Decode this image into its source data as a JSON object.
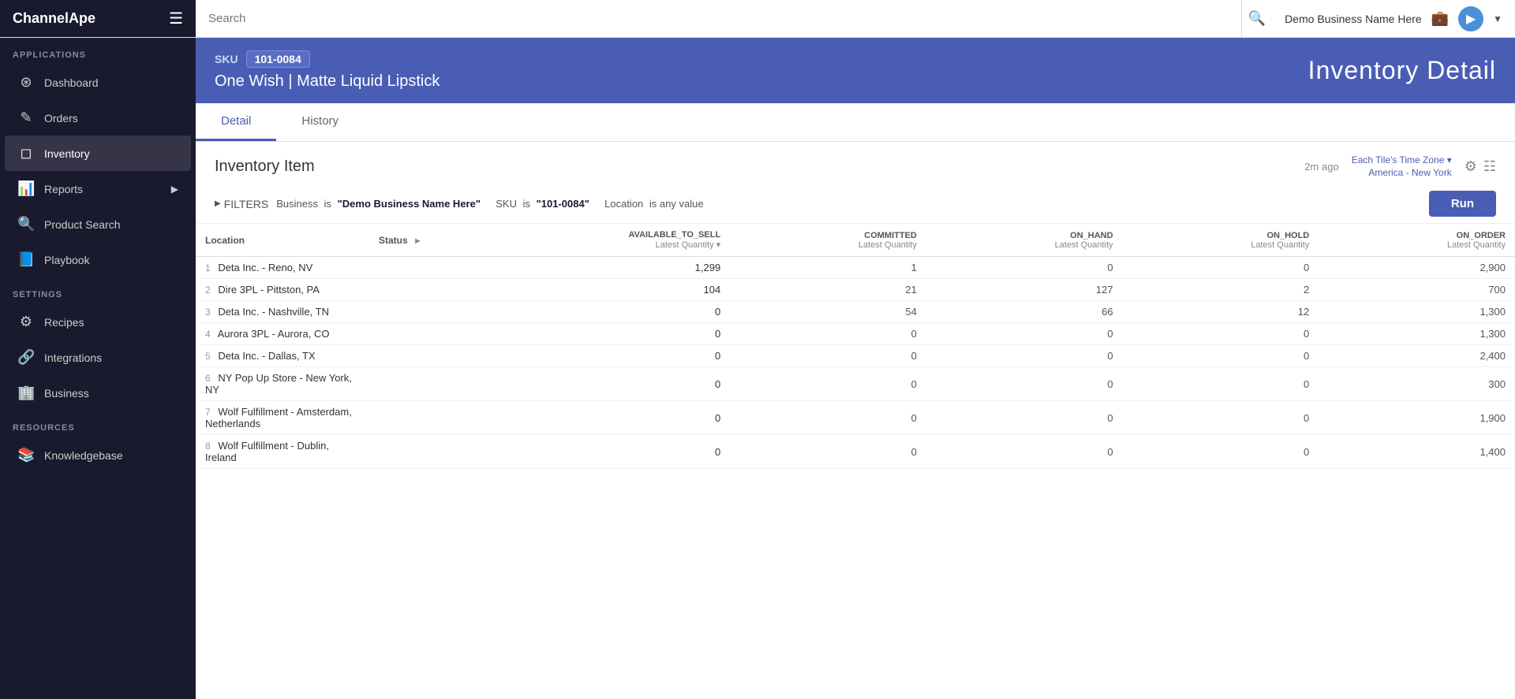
{
  "topbar": {
    "logo": "ChannelApe",
    "search_placeholder": "Search",
    "business_name": "Demo Business Name Here"
  },
  "sidebar": {
    "sections": [
      {
        "label": "APPLICATIONS",
        "items": [
          {
            "id": "dashboard",
            "label": "Dashboard",
            "icon": "⊞",
            "active": false
          },
          {
            "id": "orders",
            "label": "Orders",
            "icon": "📋",
            "active": false
          },
          {
            "id": "inventory",
            "label": "Inventory",
            "icon": "📦",
            "active": true
          },
          {
            "id": "reports",
            "label": "Reports",
            "icon": "📊",
            "active": false,
            "has_chevron": true
          },
          {
            "id": "product-search",
            "label": "Product Search",
            "icon": "🔍",
            "active": false
          },
          {
            "id": "playbook",
            "label": "Playbook",
            "icon": "📖",
            "active": false
          }
        ]
      },
      {
        "label": "SETTINGS",
        "items": [
          {
            "id": "recipes",
            "label": "Recipes",
            "icon": "⚙",
            "active": false
          },
          {
            "id": "integrations",
            "label": "Integrations",
            "icon": "🔗",
            "active": false
          },
          {
            "id": "business",
            "label": "Business",
            "icon": "🏢",
            "active": false
          }
        ]
      },
      {
        "label": "RESOURCES",
        "items": [
          {
            "id": "knowledgebase",
            "label": "Knowledgebase",
            "icon": "📚",
            "active": false
          }
        ]
      }
    ]
  },
  "header": {
    "sku_label": "SKU",
    "sku_value": "101-0084",
    "product_name": "One Wish | Matte Liquid Lipstick",
    "page_title": "Inventory Detail"
  },
  "tabs": [
    {
      "id": "detail",
      "label": "Detail",
      "active": true
    },
    {
      "id": "history",
      "label": "History",
      "active": false
    }
  ],
  "inventory_item": {
    "title": "Inventory Item",
    "timestamp": "2m ago",
    "timezone_label": "Each Tile's Time Zone ▾",
    "timezone_value": "America - New York"
  },
  "filters": {
    "toggle_label": "FILTERS",
    "items": [
      {
        "key": "Business",
        "op": "is",
        "val": "\"Demo Business Name Here\""
      },
      {
        "key": "SKU",
        "op": "is",
        "val": "\"101-0084\""
      },
      {
        "key": "Location",
        "op": "is any value",
        "val": ""
      }
    ],
    "run_label": "Run"
  },
  "table": {
    "columns": [
      {
        "id": "location",
        "label": "Location"
      },
      {
        "id": "status",
        "label": "Status"
      },
      {
        "id": "available_to_sell",
        "label": "AVAILABLE_TO_SELL",
        "sub": "Latest Quantity ▾"
      },
      {
        "id": "committed",
        "label": "COMMITTED",
        "sub": "Latest Quantity"
      },
      {
        "id": "on_hand",
        "label": "ON_HAND",
        "sub": "Latest Quantity"
      },
      {
        "id": "on_hold",
        "label": "ON_HOLD",
        "sub": "Latest Quantity"
      },
      {
        "id": "on_order",
        "label": "ON_ORDER",
        "sub": "Latest Quantity"
      }
    ],
    "rows": [
      {
        "num": 1,
        "location": "Deta Inc. - Reno, NV",
        "status": "",
        "available_to_sell": "1,299",
        "committed": "1",
        "on_hand": "0",
        "on_hold": "0",
        "on_order": "2,900"
      },
      {
        "num": 2,
        "location": "Dire 3PL - Pittston, PA",
        "status": "",
        "available_to_sell": "104",
        "committed": "21",
        "on_hand": "127",
        "on_hold": "2",
        "on_order": "700"
      },
      {
        "num": 3,
        "location": "Deta Inc. - Nashville, TN",
        "status": "",
        "available_to_sell": "0",
        "committed": "54",
        "on_hand": "66",
        "on_hold": "12",
        "on_order": "1,300"
      },
      {
        "num": 4,
        "location": "Aurora 3PL - Aurora, CO",
        "status": "",
        "available_to_sell": "0",
        "committed": "0",
        "on_hand": "0",
        "on_hold": "0",
        "on_order": "1,300"
      },
      {
        "num": 5,
        "location": "Deta Inc. - Dallas, TX",
        "status": "",
        "available_to_sell": "0",
        "committed": "0",
        "on_hand": "0",
        "on_hold": "0",
        "on_order": "2,400"
      },
      {
        "num": 6,
        "location": "NY Pop Up Store - New York, NY",
        "status": "",
        "available_to_sell": "0",
        "committed": "0",
        "on_hand": "0",
        "on_hold": "0",
        "on_order": "300"
      },
      {
        "num": 7,
        "location": "Wolf Fulfillment - Amsterdam, Netherlands",
        "status": "",
        "available_to_sell": "0",
        "committed": "0",
        "on_hand": "0",
        "on_hold": "0",
        "on_order": "1,900"
      },
      {
        "num": 8,
        "location": "Wolf Fulfillment - Dublin, Ireland",
        "status": "",
        "available_to_sell": "0",
        "committed": "0",
        "on_hand": "0",
        "on_hold": "0",
        "on_order": "1,400"
      }
    ]
  }
}
